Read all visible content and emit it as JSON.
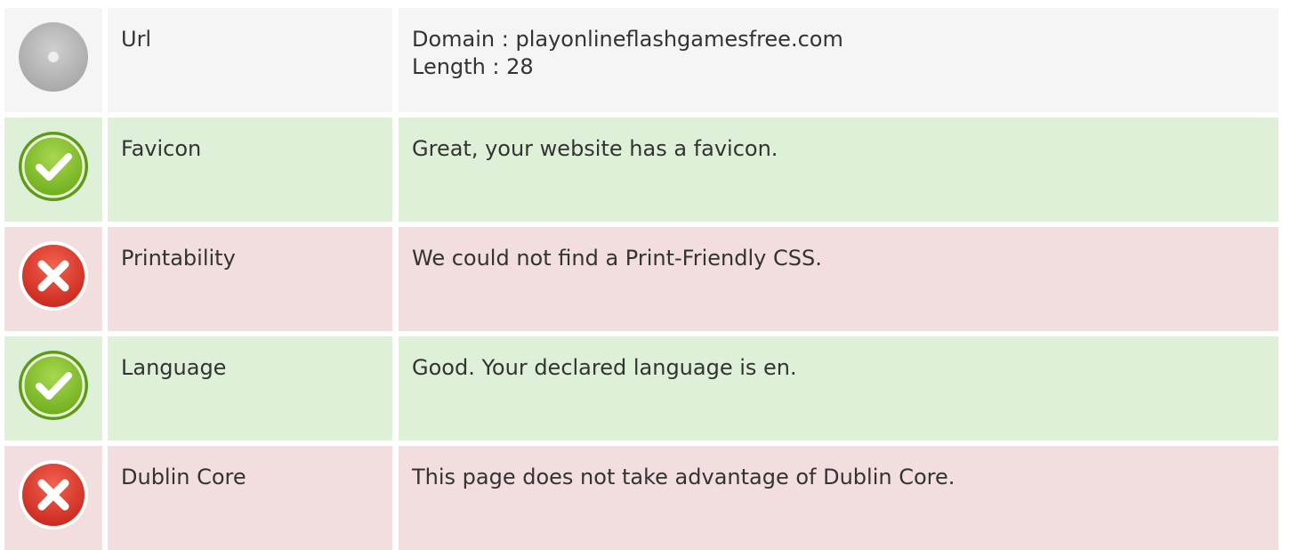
{
  "rows": [
    {
      "status": "neutral",
      "icon": "info-neutral-icon",
      "name": "Url",
      "details": [
        "Domain : playonlineflashgamesfree.com",
        "Length : 28"
      ]
    },
    {
      "status": "pass",
      "icon": "check-circle-icon",
      "name": "Favicon",
      "details": [
        "Great, your website has a favicon."
      ]
    },
    {
      "status": "fail",
      "icon": "x-circle-icon",
      "name": "Printability",
      "details": [
        "We could not find a Print-Friendly CSS."
      ]
    },
    {
      "status": "pass",
      "icon": "check-circle-icon",
      "name": "Language",
      "details": [
        "Good. Your declared language is en."
      ]
    },
    {
      "status": "fail",
      "icon": "x-circle-icon",
      "name": "Dublin Core",
      "details": [
        "This page does not take advantage of Dublin Core."
      ]
    }
  ],
  "colors": {
    "neutral_bg": "#f5f5f5",
    "pass_bg": "#dff0d8",
    "fail_bg": "#f2dede",
    "pass_icon": "#8cc63f",
    "fail_icon": "#e03a2f",
    "neutral_icon": "#bdbdbd"
  }
}
